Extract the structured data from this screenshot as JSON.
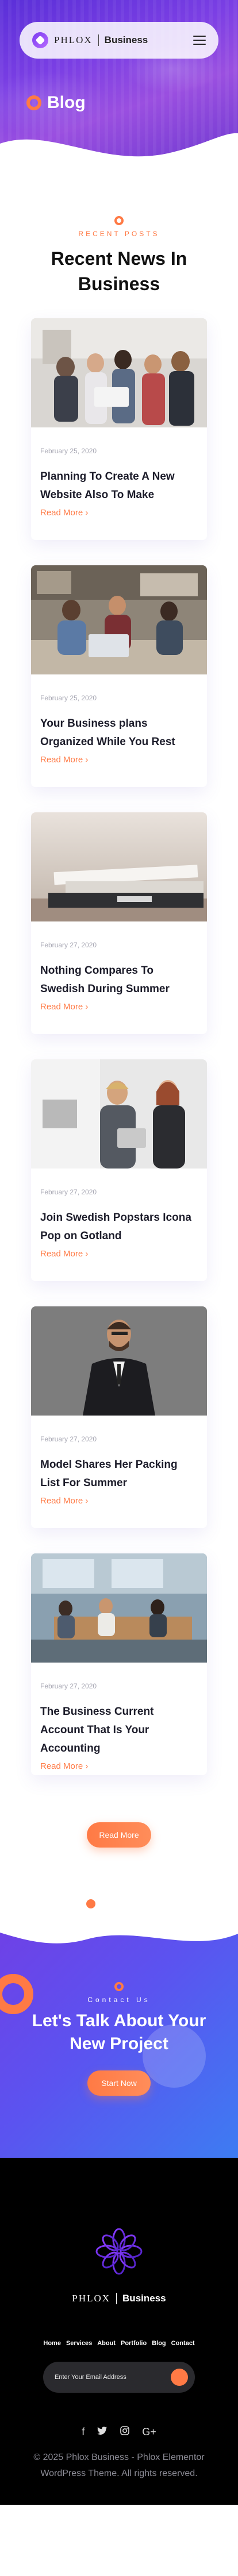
{
  "header": {
    "brand": "PHLOX",
    "brand_sub": "Business",
    "menu_icon": "hamburger-icon"
  },
  "hero": {
    "title": "Blog"
  },
  "posts_section": {
    "eyebrow": "RECENT POSTS",
    "title": "Recent News In Business",
    "read_more_button": "Read More"
  },
  "posts": [
    {
      "date": "February 25, 2020",
      "title": "Planning To Create A New Website Also To Make",
      "more": "Read More ›"
    },
    {
      "date": "February 25, 2020",
      "title": "Your Business plans Organized While You Rest",
      "more": "Read More ›"
    },
    {
      "date": "February 27, 2020",
      "title": "Nothing Compares To Swedish During Summer",
      "more": "Read More ›"
    },
    {
      "date": "February 27, 2020",
      "title": "Join Swedish Popstars Icona Pop on Gotland",
      "more": "Read More ›"
    },
    {
      "date": "February 27, 2020",
      "title": "Model Shares Her Packing List For Summer",
      "more": "Read More ›"
    },
    {
      "date": "February 27, 2020",
      "title": "The Business Current Account That Is Your Accounting",
      "more": "Read More ›"
    }
  ],
  "cta": {
    "eyebrow": "Contact Us",
    "title": "Let's Talk About Your New Project",
    "button": "Start Now"
  },
  "footer": {
    "brand": "PHLOX",
    "brand_sub": "Business",
    "nav": [
      "Home",
      "Services",
      "About",
      "Portfolio",
      "Blog",
      "Contact"
    ],
    "subscribe_placeholder": "Enter Your Email Address",
    "social_icons": [
      "facebook-icon",
      "twitter-icon",
      "instagram-icon",
      "google-plus-icon"
    ],
    "copyright": "© 2025 Phlox Business - Phlox Elementor WordPress Theme. All rights reserved."
  },
  "colors": {
    "accent": "#ff7a45",
    "hero_purple": "#6f40e6",
    "cta_blue": "#3d7cf2",
    "footer_bg": "#000000"
  }
}
